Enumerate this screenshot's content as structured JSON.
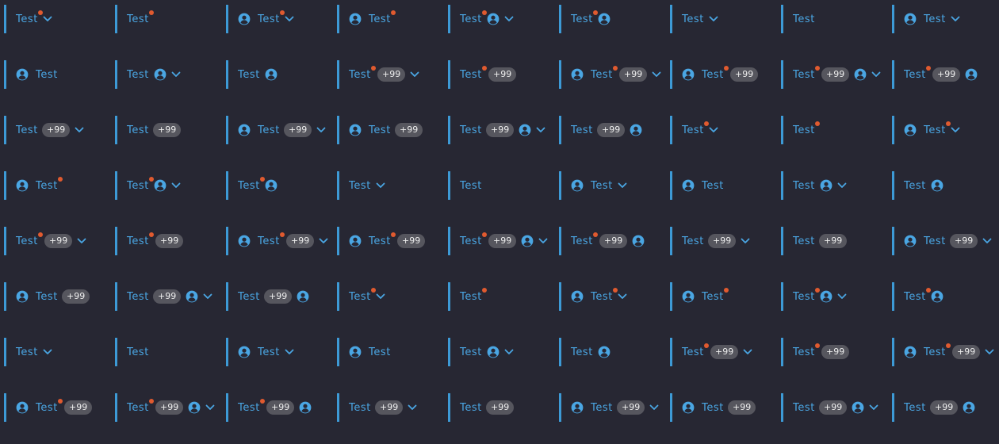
{
  "colors": {
    "background": "#272733",
    "accent": "#3d9ad6",
    "text": "#4aa6e3",
    "dot": "#e05a2f",
    "badge_bg": "#56565e",
    "badge_text": "#eeeeee"
  },
  "tab_label": "Test",
  "badge_label": "+99",
  "icons": {
    "avatar": "user-circle-icon",
    "chevron": "chevron-down-icon"
  },
  "tabs": [
    {
      "left": false,
      "dot": true,
      "badge": false,
      "right": false,
      "chev": true
    },
    {
      "left": false,
      "dot": true,
      "badge": false,
      "right": false,
      "chev": false
    },
    {
      "left": true,
      "dot": true,
      "badge": false,
      "right": false,
      "chev": true
    },
    {
      "left": true,
      "dot": true,
      "badge": false,
      "right": false,
      "chev": false
    },
    {
      "left": false,
      "dot": true,
      "badge": false,
      "right": true,
      "chev": true
    },
    {
      "left": false,
      "dot": true,
      "badge": false,
      "right": true,
      "chev": false
    },
    {
      "left": false,
      "dot": false,
      "badge": false,
      "right": false,
      "chev": true
    },
    {
      "left": false,
      "dot": false,
      "badge": false,
      "right": false,
      "chev": false
    },
    {
      "left": true,
      "dot": false,
      "badge": false,
      "right": false,
      "chev": true
    },
    {
      "left": true,
      "dot": false,
      "badge": false,
      "right": false,
      "chev": false
    },
    {
      "left": false,
      "dot": false,
      "badge": false,
      "right": true,
      "chev": true
    },
    {
      "left": false,
      "dot": false,
      "badge": false,
      "right": true,
      "chev": false
    },
    {
      "left": false,
      "dot": true,
      "badge": true,
      "right": false,
      "chev": true
    },
    {
      "left": false,
      "dot": true,
      "badge": true,
      "right": false,
      "chev": false
    },
    {
      "left": true,
      "dot": true,
      "badge": true,
      "right": false,
      "chev": true
    },
    {
      "left": true,
      "dot": true,
      "badge": true,
      "right": false,
      "chev": false
    },
    {
      "left": false,
      "dot": true,
      "badge": true,
      "right": true,
      "chev": true
    },
    {
      "left": false,
      "dot": true,
      "badge": true,
      "right": true,
      "chev": false
    },
    {
      "left": false,
      "dot": false,
      "badge": true,
      "right": false,
      "chev": true
    },
    {
      "left": false,
      "dot": false,
      "badge": true,
      "right": false,
      "chev": false
    },
    {
      "left": true,
      "dot": false,
      "badge": true,
      "right": false,
      "chev": true
    },
    {
      "left": true,
      "dot": false,
      "badge": true,
      "right": false,
      "chev": false
    },
    {
      "left": false,
      "dot": false,
      "badge": true,
      "right": true,
      "chev": true
    },
    {
      "left": false,
      "dot": false,
      "badge": true,
      "right": true,
      "chev": false
    },
    {
      "left": false,
      "dot": true,
      "badge": false,
      "right": false,
      "chev": true
    },
    {
      "left": false,
      "dot": true,
      "badge": false,
      "right": false,
      "chev": false
    },
    {
      "left": true,
      "dot": true,
      "badge": false,
      "right": false,
      "chev": true
    },
    {
      "left": true,
      "dot": true,
      "badge": false,
      "right": false,
      "chev": false
    },
    {
      "left": false,
      "dot": true,
      "badge": false,
      "right": true,
      "chev": true
    },
    {
      "left": false,
      "dot": true,
      "badge": false,
      "right": true,
      "chev": false
    },
    {
      "left": false,
      "dot": false,
      "badge": false,
      "right": false,
      "chev": true
    },
    {
      "left": false,
      "dot": false,
      "badge": false,
      "right": false,
      "chev": false
    },
    {
      "left": true,
      "dot": false,
      "badge": false,
      "right": false,
      "chev": true
    },
    {
      "left": true,
      "dot": false,
      "badge": false,
      "right": false,
      "chev": false
    },
    {
      "left": false,
      "dot": false,
      "badge": false,
      "right": true,
      "chev": true
    },
    {
      "left": false,
      "dot": false,
      "badge": false,
      "right": true,
      "chev": false
    },
    {
      "left": false,
      "dot": true,
      "badge": true,
      "right": false,
      "chev": true
    },
    {
      "left": false,
      "dot": true,
      "badge": true,
      "right": false,
      "chev": false
    },
    {
      "left": true,
      "dot": true,
      "badge": true,
      "right": false,
      "chev": true
    },
    {
      "left": true,
      "dot": true,
      "badge": true,
      "right": false,
      "chev": false
    },
    {
      "left": false,
      "dot": true,
      "badge": true,
      "right": true,
      "chev": true
    },
    {
      "left": false,
      "dot": true,
      "badge": true,
      "right": true,
      "chev": false
    },
    {
      "left": false,
      "dot": false,
      "badge": true,
      "right": false,
      "chev": true
    },
    {
      "left": false,
      "dot": false,
      "badge": true,
      "right": false,
      "chev": false
    },
    {
      "left": true,
      "dot": false,
      "badge": true,
      "right": false,
      "chev": true
    },
    {
      "left": true,
      "dot": false,
      "badge": true,
      "right": false,
      "chev": false
    },
    {
      "left": false,
      "dot": false,
      "badge": true,
      "right": true,
      "chev": true
    },
    {
      "left": false,
      "dot": false,
      "badge": true,
      "right": true,
      "chev": false
    },
    {
      "left": false,
      "dot": true,
      "badge": false,
      "right": false,
      "chev": true
    },
    {
      "left": false,
      "dot": true,
      "badge": false,
      "right": false,
      "chev": false
    },
    {
      "left": true,
      "dot": true,
      "badge": false,
      "right": false,
      "chev": true
    },
    {
      "left": true,
      "dot": true,
      "badge": false,
      "right": false,
      "chev": false
    },
    {
      "left": false,
      "dot": true,
      "badge": false,
      "right": true,
      "chev": true
    },
    {
      "left": false,
      "dot": true,
      "badge": false,
      "right": true,
      "chev": false
    },
    {
      "left": false,
      "dot": false,
      "badge": false,
      "right": false,
      "chev": true
    },
    {
      "left": false,
      "dot": false,
      "badge": false,
      "right": false,
      "chev": false
    },
    {
      "left": true,
      "dot": false,
      "badge": false,
      "right": false,
      "chev": true
    },
    {
      "left": true,
      "dot": false,
      "badge": false,
      "right": false,
      "chev": false
    },
    {
      "left": false,
      "dot": false,
      "badge": false,
      "right": true,
      "chev": true
    },
    {
      "left": false,
      "dot": false,
      "badge": false,
      "right": true,
      "chev": false
    },
    {
      "left": false,
      "dot": true,
      "badge": true,
      "right": false,
      "chev": true
    },
    {
      "left": false,
      "dot": true,
      "badge": true,
      "right": false,
      "chev": false
    },
    {
      "left": true,
      "dot": true,
      "badge": true,
      "right": false,
      "chev": true
    },
    {
      "left": true,
      "dot": true,
      "badge": true,
      "right": false,
      "chev": false
    },
    {
      "left": false,
      "dot": true,
      "badge": true,
      "right": true,
      "chev": true
    },
    {
      "left": false,
      "dot": true,
      "badge": true,
      "right": true,
      "chev": false
    },
    {
      "left": false,
      "dot": false,
      "badge": true,
      "right": false,
      "chev": true
    },
    {
      "left": false,
      "dot": false,
      "badge": true,
      "right": false,
      "chev": false
    },
    {
      "left": true,
      "dot": false,
      "badge": true,
      "right": false,
      "chev": true
    },
    {
      "left": true,
      "dot": false,
      "badge": true,
      "right": false,
      "chev": false
    },
    {
      "left": false,
      "dot": false,
      "badge": true,
      "right": true,
      "chev": true
    },
    {
      "left": false,
      "dot": false,
      "badge": true,
      "right": true,
      "chev": false
    }
  ]
}
